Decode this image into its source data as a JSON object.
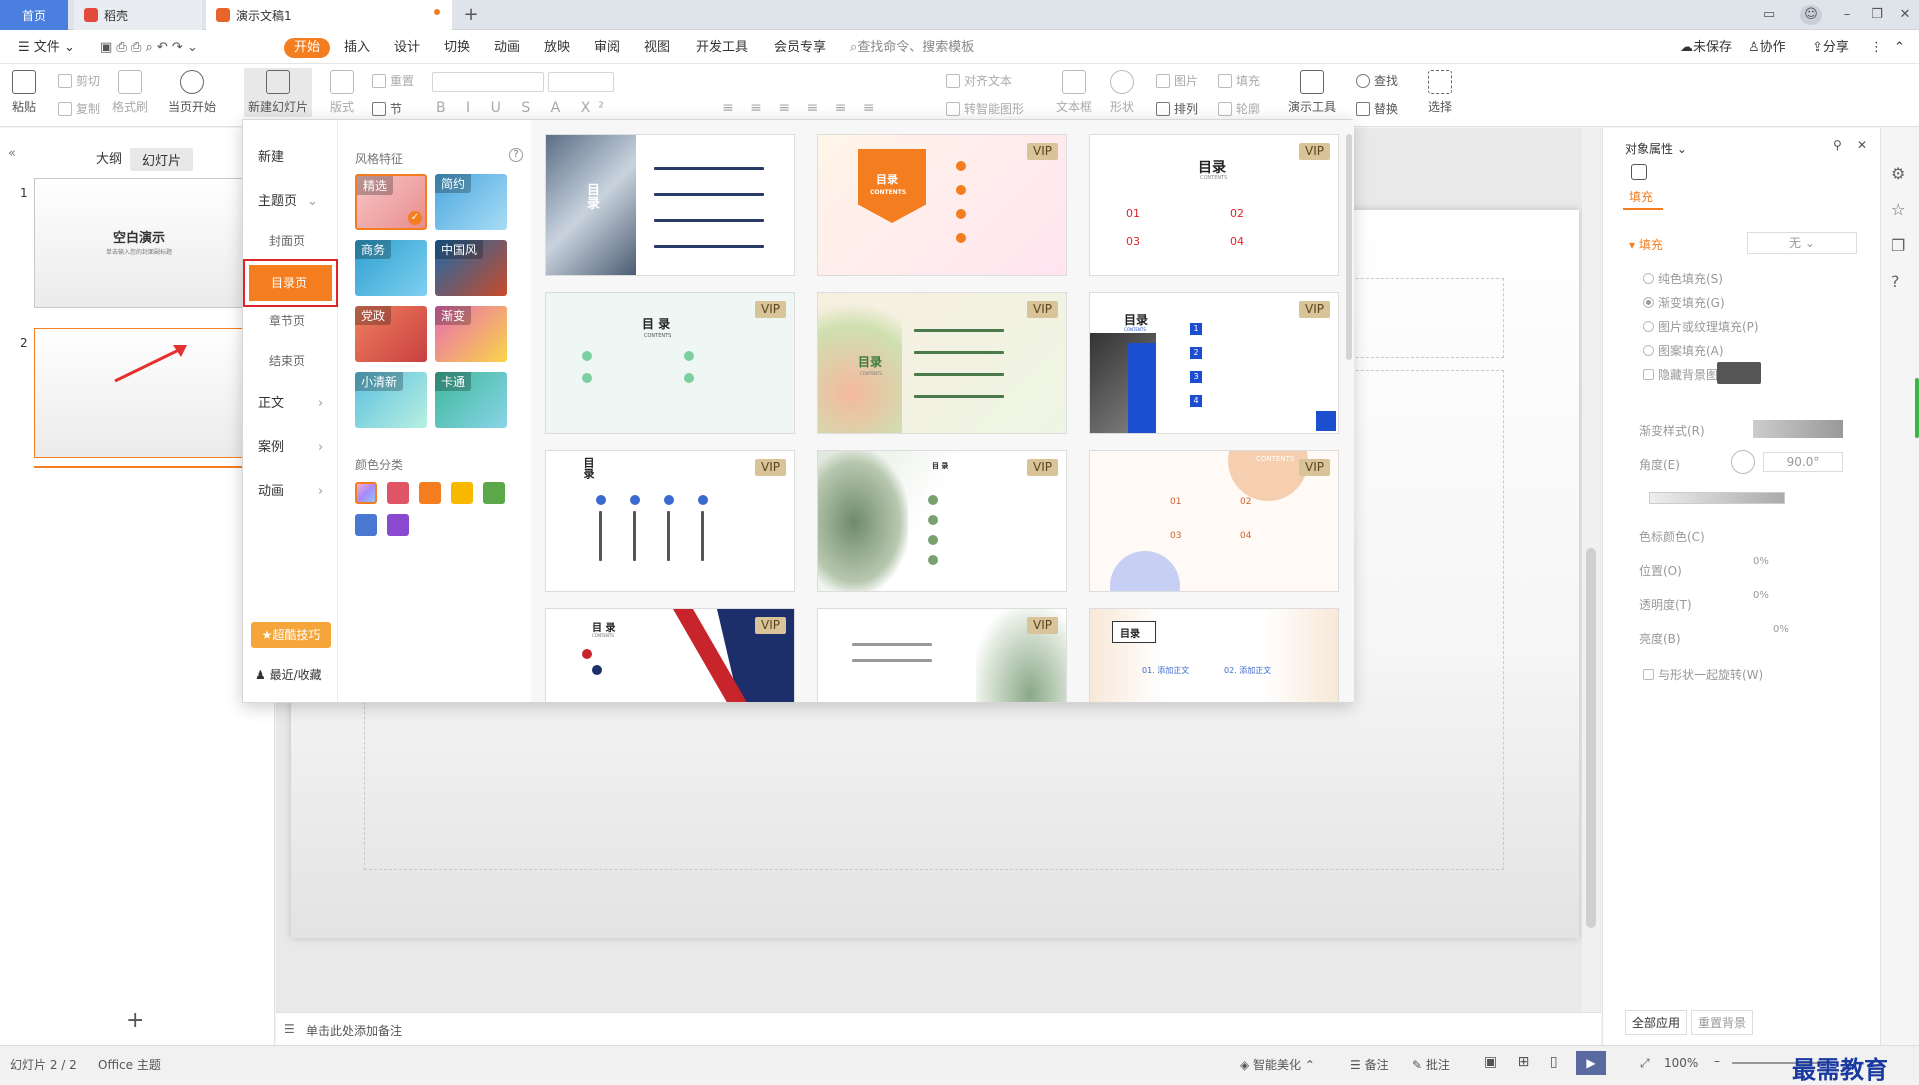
{
  "tabs": {
    "home": "首页",
    "docer": "稻壳",
    "doc": "演示文稿1"
  },
  "menus": [
    "文件",
    "开始",
    "插入",
    "设计",
    "切换",
    "动画",
    "放映",
    "审阅",
    "视图",
    "开发工具",
    "会员专享"
  ],
  "search_placeholder": "查找命令、搜索模板",
  "menubar_right": {
    "unsaved": "未保存",
    "collab": "协作",
    "share": "分享"
  },
  "ribbon": {
    "paste": "粘贴",
    "cut": "剪切",
    "copy": "复制",
    "format_painter": "格式刷",
    "from_current": "当页开始",
    "new_slide": "新建幻灯片",
    "layout": "版式",
    "section": "节",
    "reset": "重置",
    "align_text": "对齐文本",
    "smart_shape": "转智能图形",
    "textbox": "文本框",
    "shape": "形状",
    "picture": "图片",
    "fill": "填充",
    "arrange": "排列",
    "outline": "轮廓",
    "presenter_tools": "演示工具",
    "find": "查找",
    "replace": "替换",
    "select": "选择"
  },
  "left_panel": {
    "outline": "大纲",
    "slides": "幻灯片",
    "slide1_title": "空白演示",
    "slide1_sub": "单击输入您的封面副标题",
    "n1": "1",
    "n2": "2"
  },
  "notes_placeholder": "单击此处添加备注",
  "dropdown": {
    "new": "新建",
    "theme_page": "主题页",
    "cover": "封面页",
    "toc": "目录页",
    "chapter": "章节页",
    "ending": "结束页",
    "body": "正文",
    "case": "案例",
    "animation": "动画",
    "tips_button": "超酷技巧",
    "recent": "最近/收藏",
    "style_header": "风格特征",
    "color_header": "颜色分类",
    "styles": [
      "精选",
      "简约",
      "商务",
      "中国风",
      "党政",
      "渐变",
      "小清新",
      "卡通"
    ],
    "swatches": [
      "#a78bfa",
      "#e05565",
      "#f47e1f",
      "#f8b800",
      "#5aa84a",
      "#4a78d0",
      "#8a4ad0"
    ],
    "vip": "VIP",
    "card_texts": {
      "c1_title": "目录",
      "c2_title": "目录",
      "c2_sub": "CONTENTS",
      "c3_title": "目录",
      "c3_sub": "CONTENTS",
      "c4_title": "目 录",
      "c4_sub": "CONTENTS",
      "c5_title": "目录",
      "c5_sub": "CONTENTS",
      "c6_title": "目录",
      "c6_sub": "CONTENTS",
      "c7_title": "目录",
      "c8_title": "目 录",
      "c9_sub": "CONTENTS",
      "c10_title": "目 录",
      "c10_sub": "CONTENTS",
      "c12_title": "目录",
      "n01": "01",
      "n02": "02",
      "n03": "03",
      "n04": "04",
      "c12_i1": "01. 添加正文",
      "c12_i2": "02. 添加正文",
      "num1": "1",
      "num2": "2",
      "num3": "3",
      "num4": "4"
    }
  },
  "right_panel": {
    "title": "对象属性",
    "fill_tab": "填充",
    "fill_section": "填充",
    "fill_value": "无",
    "options": [
      "纯色填充(S)",
      "渐变填充(G)",
      "图片或纹理填充(P)",
      "图案填充(A)"
    ],
    "hide_bg": "隐藏背景图",
    "gradient_style": "渐变样式(R)",
    "angle": "角度(E)",
    "angle_value": "90.0°",
    "color_stop": "色标颜色(C)",
    "position": "位置(O)",
    "transparency": "透明度(T)",
    "brightness": "亮度(B)",
    "pct": "0%",
    "rotate_with_shape": "与形状一起旋转(W)",
    "apply_all": "全部应用",
    "reset_bg": "重置背景"
  },
  "status": {
    "slide_count": "幻灯片 2 / 2",
    "theme": "Office 主题",
    "beautify": "智能美化",
    "notes": "备注",
    "comments": "批注",
    "zoom": "100%",
    "watermark": "最需教育"
  }
}
